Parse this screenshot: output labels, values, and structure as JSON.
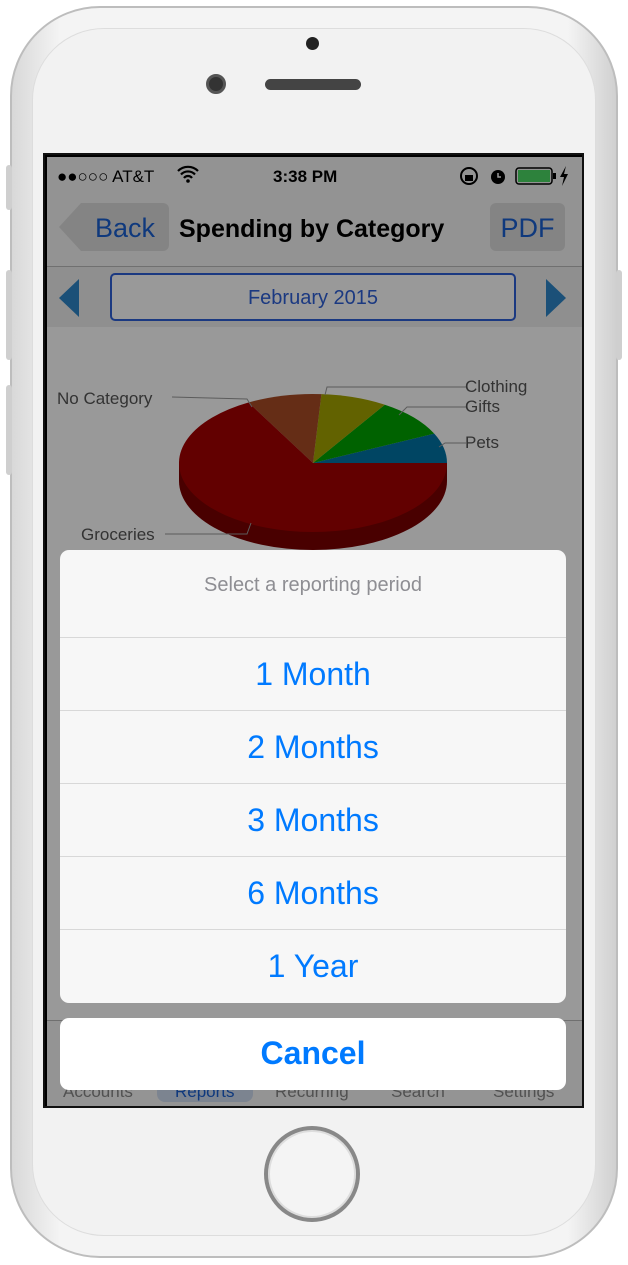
{
  "status_bar": {
    "carrier": "●●○○○ AT&T",
    "time": "3:38 PM",
    "icons": [
      "wifi-icon",
      "rotation-lock-icon",
      "alarm-icon",
      "battery-icon",
      "charging-icon"
    ]
  },
  "nav": {
    "back_label": "Back",
    "title": "Spending by Category",
    "pdf_label": "PDF"
  },
  "period": {
    "label": "February 2015"
  },
  "chart_data": {
    "type": "pie",
    "style": "3d",
    "slices": [
      {
        "label": "Pets",
        "value": 7,
        "color": "#0073a6"
      },
      {
        "label": "Gifts",
        "value": 9,
        "color": "#00a400"
      },
      {
        "label": "Clothing",
        "value": 8,
        "color": "#a4a400"
      },
      {
        "label": "No Category",
        "value": 9,
        "color": "#a84c26"
      },
      {
        "label": "Groceries",
        "value": 67,
        "color": "#a40000"
      }
    ]
  },
  "tabs": [
    {
      "label": "Accounts"
    },
    {
      "label": "Reports",
      "active": true
    },
    {
      "label": "Recurring"
    },
    {
      "label": "Search"
    },
    {
      "label": "Settings"
    }
  ],
  "action_sheet": {
    "title": "Select a reporting period",
    "options": [
      "1 Month",
      "2 Months",
      "3 Months",
      "6 Months",
      "1 Year"
    ],
    "cancel_label": "Cancel"
  },
  "colors": {
    "accent": "#007aff",
    "nav_blue": "#1a5fd0"
  }
}
